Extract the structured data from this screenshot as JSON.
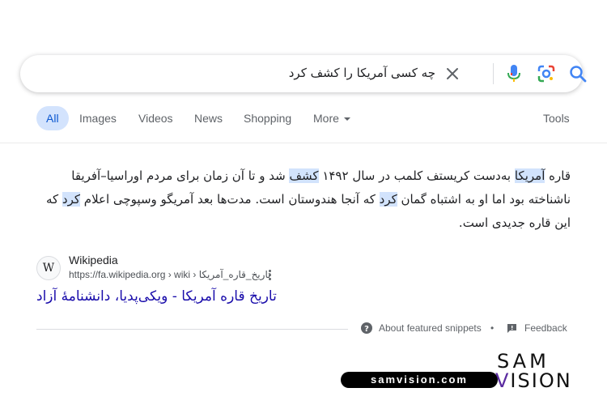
{
  "search": {
    "query": "چه کسی آمریکا را کشف کرد"
  },
  "tabs": [
    {
      "label": "All",
      "active": true
    },
    {
      "label": "Images"
    },
    {
      "label": "Videos"
    },
    {
      "label": "News"
    },
    {
      "label": "Shopping"
    },
    {
      "label": "More"
    }
  ],
  "tools_label": "Tools",
  "snippet": {
    "p1": "قاره ",
    "h1": "آمریکا",
    "p2": " به‌دست کریستف کلمب در سال ۱۴۹۲ ",
    "h2": "کشف",
    "p3": " شد و تا آن زمان برای مردم اوراسیا–آفریقا ناشناخته بود اما او به اشتباه گمان ",
    "h3": "کرد",
    "p4": " که آنجا هندوستان است. مدت‌ها بعد آمریگو وسپوچی اعلام ",
    "h4": "کرد",
    "p5": " که این قاره جدیدی است."
  },
  "source": {
    "favicon_letter": "W",
    "name": "Wikipedia",
    "url": "https://fa.wikipedia.org › wiki › تاریخ_قاره_آمریکا"
  },
  "result_title": "تاریخ قاره آمریکا - ویکی‌پدیا، دانشنامهٔ آزاد",
  "footer": {
    "about": "About featured snippets",
    "dot": "•",
    "feedback": "Feedback"
  },
  "brand": {
    "site": "samvision.com",
    "logo_top": "SAM",
    "logo_v": "V",
    "logo_rest": "ISION"
  },
  "colors": {
    "highlight": "#d2e3fc",
    "link": "#1a0dab",
    "accent": "#0b57d0"
  }
}
